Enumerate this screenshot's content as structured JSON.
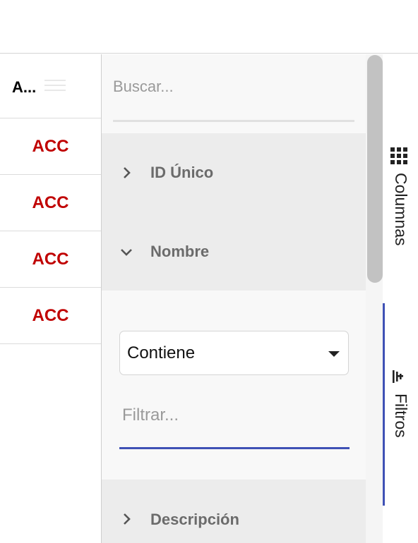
{
  "grid": {
    "header_label": "A...",
    "rows": [
      "ACC",
      "ACC",
      "ACC",
      "ACC"
    ]
  },
  "tool_panel": {
    "search_placeholder": "Buscar...",
    "groups": {
      "id": {
        "label": "ID Único",
        "expanded": false
      },
      "name": {
        "label": "Nombre",
        "expanded": true
      },
      "desc": {
        "label": "Descripción",
        "expanded": false
      }
    },
    "filter": {
      "condition": "Contiene",
      "placeholder": "Filtrar..."
    }
  },
  "side_bar": {
    "columns_label": "Columnas",
    "filters_label": "Filtros",
    "active_tab": "filtros"
  },
  "colors": {
    "value_red": "#c00000",
    "accent": "#3f51b5"
  }
}
